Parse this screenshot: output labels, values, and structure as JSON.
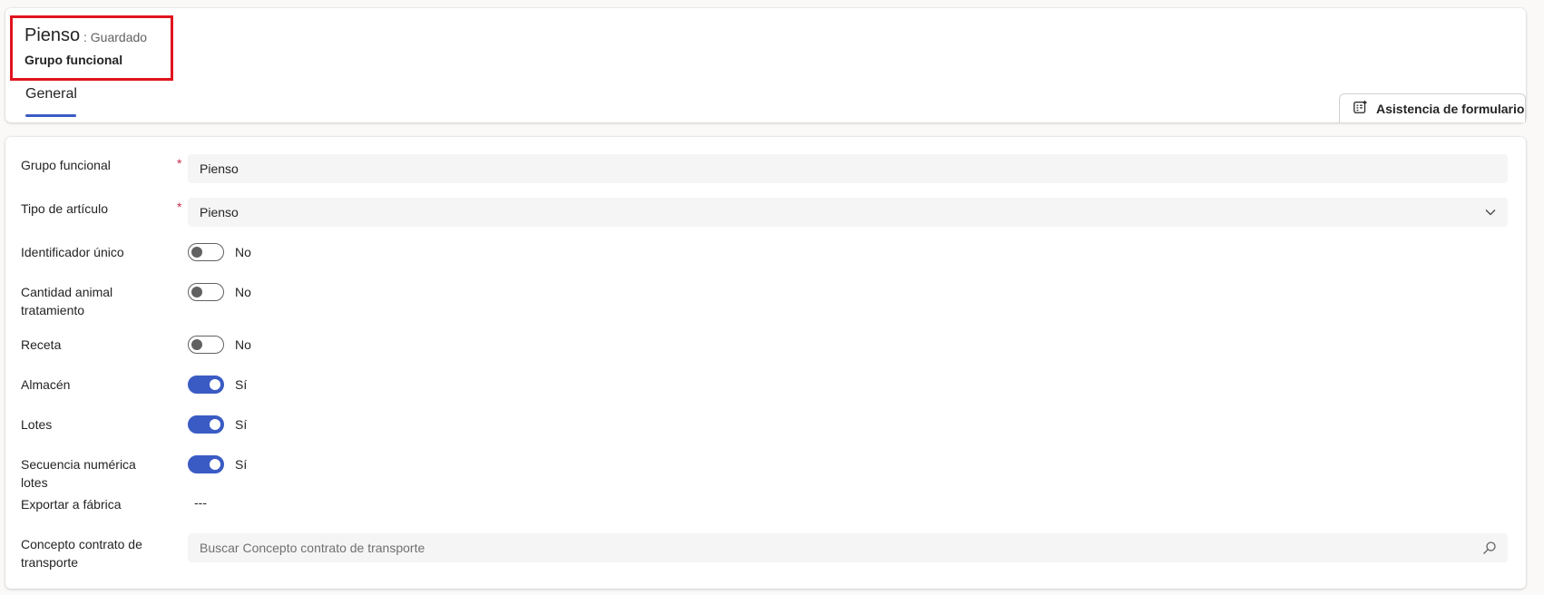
{
  "header": {
    "record_title": "Pienso",
    "record_status": ": Guardado",
    "entity_name": "Grupo funcional",
    "tabs": [
      {
        "label": "General",
        "selected": true
      }
    ],
    "assist_button": {
      "label": "Asistencia de formulario",
      "icon": "form-assist-icon"
    },
    "highlight_color": "#e0141e",
    "accent_color": "#3b5bc4"
  },
  "form": {
    "fields": [
      {
        "label": "Grupo funcional",
        "required": true,
        "type": "text",
        "value": "Pienso"
      },
      {
        "label": "Tipo de artículo",
        "required": true,
        "type": "select",
        "value": "Pienso"
      },
      {
        "label": "Identificador único",
        "type": "toggle",
        "on": false,
        "value_text": "No"
      },
      {
        "label": "Cantidad animal tratamiento",
        "type": "toggle",
        "on": false,
        "value_text": "No"
      },
      {
        "label": "Receta",
        "type": "toggle",
        "on": false,
        "value_text": "No"
      },
      {
        "label": "Almacén",
        "type": "toggle",
        "on": true,
        "value_text": "Sí"
      },
      {
        "label": "Lotes",
        "type": "toggle",
        "on": true,
        "value_text": "Sí"
      },
      {
        "label": "Secuencia numérica lotes",
        "type": "toggle",
        "on": true,
        "value_text": "Sí"
      },
      {
        "label": "Exportar a fábrica",
        "type": "readonly",
        "value": "---"
      },
      {
        "label": "Concepto contrato de transporte",
        "type": "lookup",
        "placeholder": "Buscar Concepto contrato de transporte",
        "icon": "search-icon"
      }
    ],
    "required_mark": "*"
  }
}
